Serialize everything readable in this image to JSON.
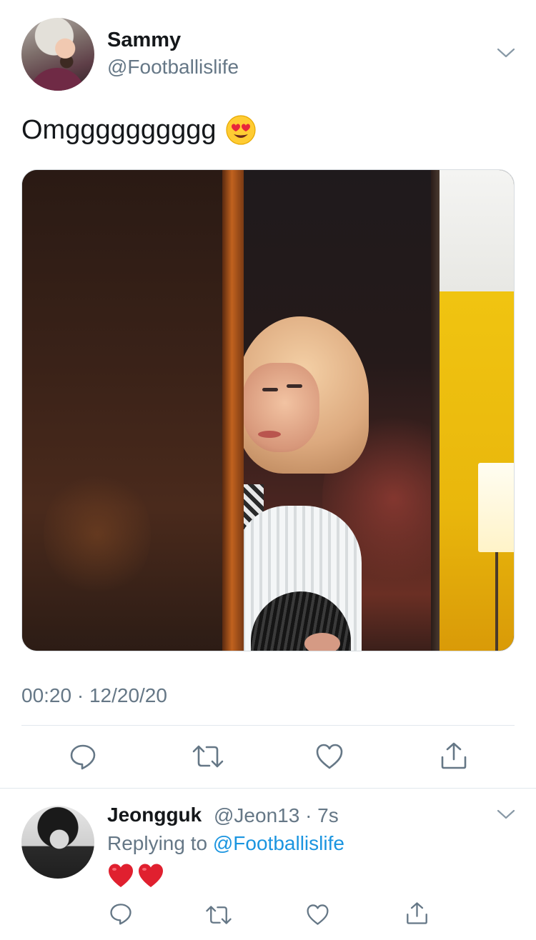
{
  "main_tweet": {
    "display_name": "Sammy",
    "handle": "@Footballislife",
    "text": "Omgggggggggg",
    "emoji": "smiling-face-with-heart-eyes",
    "timestamp": "00:20 · 12/20/20"
  },
  "actions": [
    "reply",
    "retweet",
    "like",
    "share"
  ],
  "reply": {
    "display_name": "Jeongguk",
    "handle": "@Jeon13",
    "time": "· 7s",
    "context_prefix": "Replying to",
    "context_mention": "@Footballislife",
    "emoji": [
      "red-heart",
      "red-heart"
    ]
  },
  "colors": {
    "text_primary": "#14171a",
    "text_secondary": "#657786",
    "link": "#1b95e0",
    "divider": "#e1e8ed"
  }
}
